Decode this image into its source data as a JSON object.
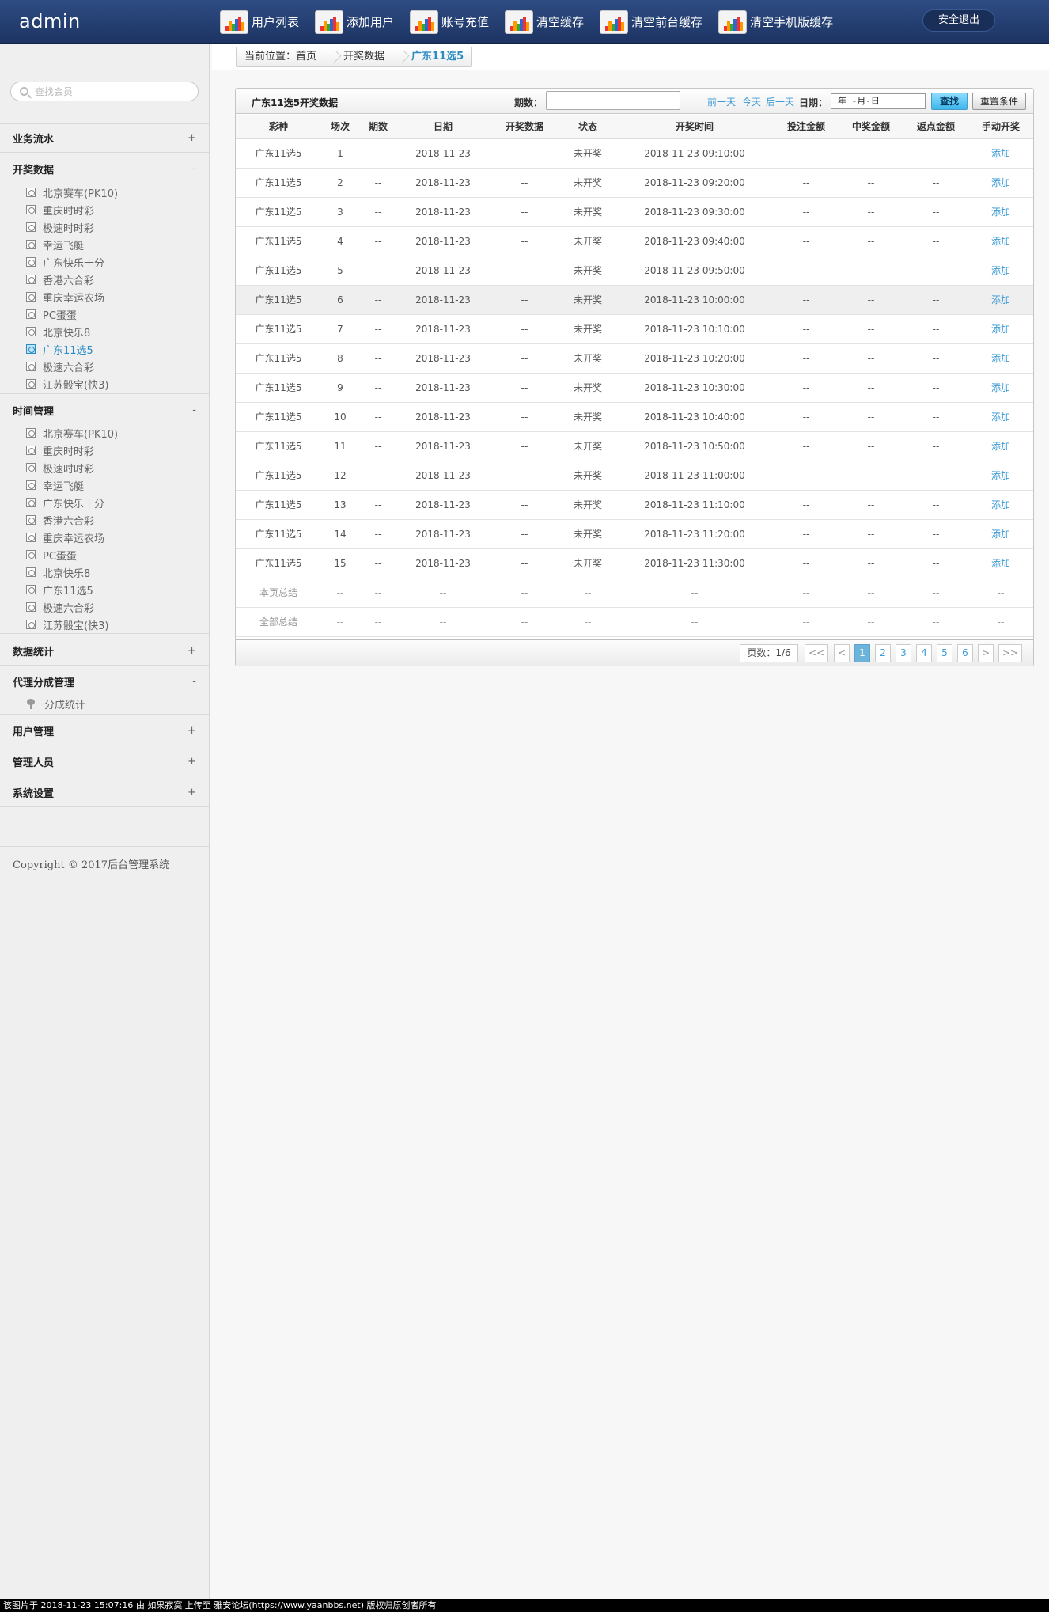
{
  "app": {
    "brand": "admin",
    "logout_label": "安全退出"
  },
  "topnav": [
    {
      "label": "用户列表",
      "icon": "bar-chart-icon"
    },
    {
      "label": "添加用户",
      "icon": "bar-chart-icon"
    },
    {
      "label": "账号充值",
      "icon": "bar-chart-icon"
    },
    {
      "label": "清空缓存",
      "icon": "bar-chart-icon"
    },
    {
      "label": "清空前台缓存",
      "icon": "bar-chart-icon"
    },
    {
      "label": "清空手机版缓存",
      "icon": "bar-chart-icon"
    }
  ],
  "sidebar": {
    "search_placeholder": "查找会员",
    "sections": [
      {
        "label": "业务流水",
        "toggle": "+"
      },
      {
        "label": "开奖数据",
        "toggle": "-"
      },
      {
        "label": "时间管理",
        "toggle": "-"
      },
      {
        "label": "数据统计",
        "toggle": "+"
      },
      {
        "label": "代理分成管理",
        "toggle": "-"
      },
      {
        "label": "用户管理",
        "toggle": "+"
      },
      {
        "label": "管理人员",
        "toggle": "+"
      },
      {
        "label": "系统设置",
        "toggle": "+"
      }
    ],
    "draw_items": [
      "北京赛车(PK10)",
      "重庆时时彩",
      "极速时时彩",
      "幸运飞艇",
      "广东快乐十分",
      "香港六合彩",
      "重庆幸运农场",
      "PC蛋蛋",
      "北京快乐8",
      "广东11选5",
      "极速六合彩",
      "江苏骰宝(快3)"
    ],
    "time_items": [
      "北京赛车(PK10)",
      "重庆时时彩",
      "极速时时彩",
      "幸运飞艇",
      "广东快乐十分",
      "香港六合彩",
      "重庆幸运农场",
      "PC蛋蛋",
      "北京快乐8",
      "广东11选5",
      "极速六合彩",
      "江苏骰宝(快3)"
    ],
    "agent_items": [
      "分成统计"
    ],
    "active_draw_item": "广东11选5",
    "copyright": "Copyright © 2017后台管理系统"
  },
  "breadcrumb": {
    "prefix": "当前位置：",
    "home": "首页",
    "section": "开奖数据",
    "current": "广东11选5"
  },
  "panel": {
    "title": "广东11选5开奖数据",
    "period_label": "期数：",
    "prev_day": "前一天",
    "today": "今天",
    "next_day": "后一天",
    "date_label": "日期：",
    "date_value": "年 -月-日",
    "search_label": "查找",
    "reset_label": "重置条件"
  },
  "table": {
    "columns": [
      "彩种",
      "场次",
      "期数",
      "日期",
      "开奖数据",
      "状态",
      "开奖时间",
      "投注金额",
      "中奖金额",
      "返点金额",
      "手动开奖"
    ],
    "rows": [
      [
        "广东11选5",
        "1",
        "--",
        "2018-11-23",
        "--",
        "未开奖",
        "2018-11-23 09:10:00",
        "--",
        "--",
        "--",
        "添加"
      ],
      [
        "广东11选5",
        "2",
        "--",
        "2018-11-23",
        "--",
        "未开奖",
        "2018-11-23 09:20:00",
        "--",
        "--",
        "--",
        "添加"
      ],
      [
        "广东11选5",
        "3",
        "--",
        "2018-11-23",
        "--",
        "未开奖",
        "2018-11-23 09:30:00",
        "--",
        "--",
        "--",
        "添加"
      ],
      [
        "广东11选5",
        "4",
        "--",
        "2018-11-23",
        "--",
        "未开奖",
        "2018-11-23 09:40:00",
        "--",
        "--",
        "--",
        "添加"
      ],
      [
        "广东11选5",
        "5",
        "--",
        "2018-11-23",
        "--",
        "未开奖",
        "2018-11-23 09:50:00",
        "--",
        "--",
        "--",
        "添加"
      ],
      [
        "广东11选5",
        "6",
        "--",
        "2018-11-23",
        "--",
        "未开奖",
        "2018-11-23 10:00:00",
        "--",
        "--",
        "--",
        "添加"
      ],
      [
        "广东11选5",
        "7",
        "--",
        "2018-11-23",
        "--",
        "未开奖",
        "2018-11-23 10:10:00",
        "--",
        "--",
        "--",
        "添加"
      ],
      [
        "广东11选5",
        "8",
        "--",
        "2018-11-23",
        "--",
        "未开奖",
        "2018-11-23 10:20:00",
        "--",
        "--",
        "--",
        "添加"
      ],
      [
        "广东11选5",
        "9",
        "--",
        "2018-11-23",
        "--",
        "未开奖",
        "2018-11-23 10:30:00",
        "--",
        "--",
        "--",
        "添加"
      ],
      [
        "广东11选5",
        "10",
        "--",
        "2018-11-23",
        "--",
        "未开奖",
        "2018-11-23 10:40:00",
        "--",
        "--",
        "--",
        "添加"
      ],
      [
        "广东11选5",
        "11",
        "--",
        "2018-11-23",
        "--",
        "未开奖",
        "2018-11-23 10:50:00",
        "--",
        "--",
        "--",
        "添加"
      ],
      [
        "广东11选5",
        "12",
        "--",
        "2018-11-23",
        "--",
        "未开奖",
        "2018-11-23 11:00:00",
        "--",
        "--",
        "--",
        "添加"
      ],
      [
        "广东11选5",
        "13",
        "--",
        "2018-11-23",
        "--",
        "未开奖",
        "2018-11-23 11:10:00",
        "--",
        "--",
        "--",
        "添加"
      ],
      [
        "广东11选5",
        "14",
        "--",
        "2018-11-23",
        "--",
        "未开奖",
        "2018-11-23 11:20:00",
        "--",
        "--",
        "--",
        "添加"
      ],
      [
        "广东11选5",
        "15",
        "--",
        "2018-11-23",
        "--",
        "未开奖",
        "2018-11-23 11:30:00",
        "--",
        "--",
        "--",
        "添加"
      ]
    ],
    "summary_rows": [
      [
        "本页总结",
        "--",
        "--",
        "--",
        "--",
        "--",
        "--",
        "--",
        "--",
        "--",
        "--"
      ],
      [
        "全部总结",
        "--",
        "--",
        "--",
        "--",
        "--",
        "--",
        "--",
        "--",
        "--",
        "--"
      ]
    ],
    "highlighted_row": 5
  },
  "pager": {
    "info": "页数：1/6",
    "first": "<<",
    "prev": "<",
    "pages": [
      "1",
      "2",
      "3",
      "4",
      "5",
      "6"
    ],
    "current_page": "1",
    "next": ">",
    "last": ">>"
  },
  "footer": {
    "text": "该图片于 2018-11-23 15:07:16 由 如果寂寞 上传至 雅安论坛(https://www.yaanbbs.net) 版权归原创者所有"
  },
  "colors": {
    "topbar": "#2e4c83",
    "accent": "#2b8cc4",
    "link": "#3b9ad6",
    "sidebar_bg": "#efeff0"
  }
}
